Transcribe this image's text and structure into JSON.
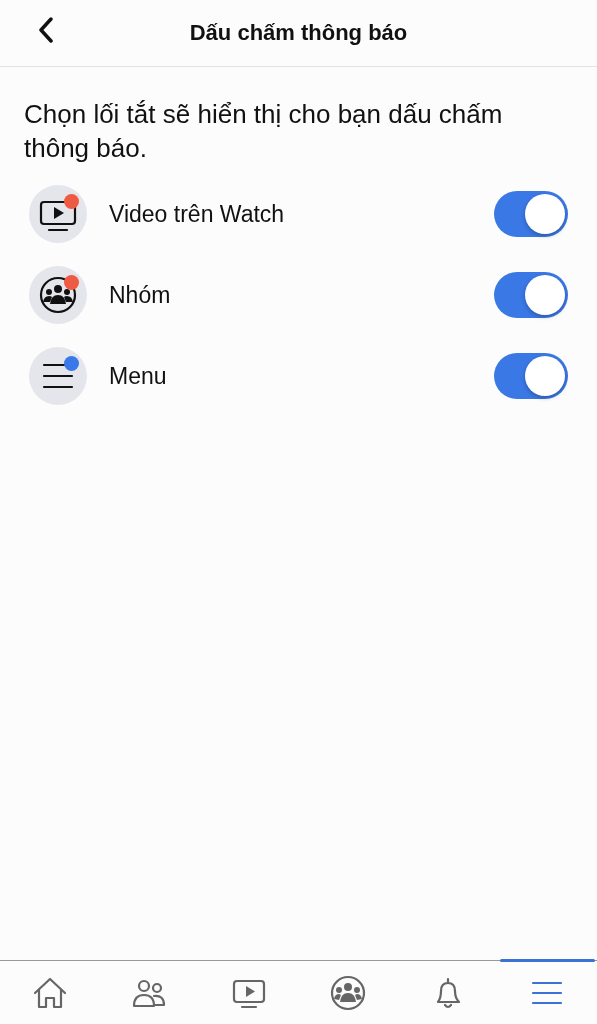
{
  "header": {
    "title": "Dấu chấm thông báo"
  },
  "description": "Chọn lối tắt sẽ hiển thị cho bạn dấu chấm thông báo.",
  "shortcuts": [
    {
      "kind": "video",
      "label": "Video trên Watch",
      "color": "#ef5a43",
      "on": true
    },
    {
      "kind": "groups",
      "label": "Nhóm",
      "color": "#ef5a43",
      "on": true
    },
    {
      "kind": "menu",
      "label": "Menu",
      "color": "#3b78e7",
      "on": true
    }
  ],
  "tab_bar": [
    {
      "kind": "home",
      "selected": false
    },
    {
      "kind": "friends",
      "selected": false
    },
    {
      "kind": "video",
      "selected": false
    },
    {
      "kind": "groups",
      "selected": false
    },
    {
      "kind": "bell",
      "selected": false
    },
    {
      "kind": "menu",
      "selected": true
    }
  ]
}
